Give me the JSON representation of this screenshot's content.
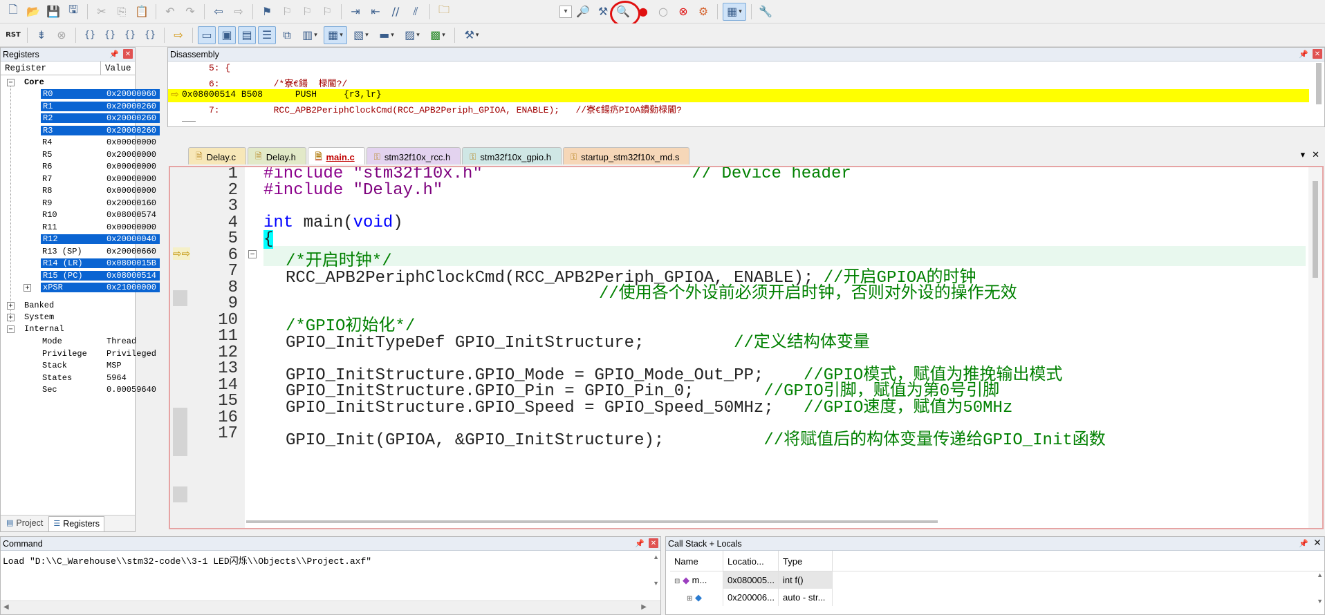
{
  "toolbar1": {
    "icons": [
      "new-file-icon",
      "open-folder-icon",
      "save-icon",
      "save-all-icon",
      "cut-icon",
      "copy-icon",
      "paste-icon",
      "undo-icon",
      "redo-icon",
      "navigate-back-icon",
      "navigate-forward-icon",
      "bookmark-icon",
      "prev-bookmark-icon",
      "next-bookmark-icon",
      "clear-bookmarks-icon",
      "indent-icon",
      "unindent-icon",
      "comment-icon",
      "uncomment-icon",
      "find-in-files-icon",
      "find-dropdown-icon",
      "incremental-find-icon",
      "configure-icon",
      "start-stop-debug-icon",
      "breakpoint-icon",
      "disable-breakpoint-icon",
      "kill-breakpoints-icon",
      "debug-settings-icon",
      "window-layout-icon",
      "configure-tools-icon"
    ]
  },
  "toolbar2": {
    "icons": [
      "reset-icon",
      "run-icon",
      "stop-icon",
      "step-into-icon",
      "step-over-icon",
      "step-out-icon",
      "run-to-cursor-icon",
      "show-next-statement-icon",
      "command-window-icon",
      "disassembly-window-icon",
      "symbols-window-icon",
      "registers-window-icon",
      "call-stack-window-icon",
      "watch-window-icon",
      "memory-window-icon",
      "serial-window-icon",
      "analysis-window-icon",
      "trace-window-icon",
      "system-viewer-icon",
      "toolbox-icon"
    ]
  },
  "registers": {
    "title": "Registers",
    "col_register": "Register",
    "col_value": "Value",
    "core_label": "Core",
    "rows": [
      {
        "name": "R0",
        "value": "0x20000060"
      },
      {
        "name": "R1",
        "value": "0x20000260"
      },
      {
        "name": "R2",
        "value": "0x20000260"
      },
      {
        "name": "R3",
        "value": "0x20000260"
      },
      {
        "name": "R4",
        "value": "0x00000000"
      },
      {
        "name": "R5",
        "value": "0x20000000"
      },
      {
        "name": "R6",
        "value": "0x00000000"
      },
      {
        "name": "R7",
        "value": "0x00000000"
      },
      {
        "name": "R8",
        "value": "0x00000000"
      },
      {
        "name": "R9",
        "value": "0x20000160"
      },
      {
        "name": "R10",
        "value": "0x08000574"
      },
      {
        "name": "R11",
        "value": "0x00000000"
      },
      {
        "name": "R12",
        "value": "0x20000040"
      },
      {
        "name": "R13 (SP)",
        "value": "0x20000660"
      },
      {
        "name": "R14 (LR)",
        "value": "0x0800015B"
      },
      {
        "name": "R15 (PC)",
        "value": "0x08000514"
      },
      {
        "name": "xPSR",
        "value": "0x21000000"
      }
    ],
    "groups": [
      "Banked",
      "System",
      "Internal"
    ],
    "internal": [
      {
        "name": "Mode",
        "value": "Thread"
      },
      {
        "name": "Privilege",
        "value": "Privileged"
      },
      {
        "name": "Stack",
        "value": "MSP"
      },
      {
        "name": "States",
        "value": "5964"
      },
      {
        "name": "Sec",
        "value": "0.00059640"
      }
    ],
    "tabs": [
      "Project",
      "Registers"
    ]
  },
  "disassembly": {
    "title": "Disassembly",
    "lines": [
      "     5: {",
      "     6:          /*寮€鍚  椂閽?/",
      "0x08000514 B508      PUSH     {r3,lr}",
      "     7:          RCC_APB2PeriphClockCmd(RCC_APB2Periph_GPIOA, ENABLE);   //寮€鍚疓PIOA鐨勬椂閽?"
    ]
  },
  "editor": {
    "tabs": [
      "Delay.c",
      "Delay.h",
      "main.c",
      "stm32f10x_rcc.h",
      "stm32f10x_gpio.h",
      "startup_stm32f10x_md.s"
    ],
    "line_numbers": [
      "1",
      "2",
      "3",
      "4",
      "5",
      "6",
      "7",
      "8",
      "9",
      "10",
      "11",
      "12",
      "13",
      "14",
      "15",
      "16",
      "17"
    ],
    "lines": {
      "l1_dir": "#include",
      "l1_str": "\"stm32f10x.h\"",
      "l1_cm": "// Device header",
      "l2_dir": "#include",
      "l2_str": "\"Delay.h\"",
      "l4_kw": "int",
      "l4_mid": " main(",
      "l4_kw2": "void",
      "l4_end": ")",
      "l5": "{",
      "l6_cm": "/*开启时钟*/",
      "l7": "RCC_APB2PeriphClockCmd(RCC_APB2Periph_GPIOA, ENABLE);",
      "l7_cm": "//开启GPIOA的时钟",
      "l8_cm": "//使用各个外设前必须开启时钟，否则对外设的操作无效",
      "l10_cm": "/*GPIO初始化*/",
      "l11": "GPIO_InitTypeDef GPIO_InitStructure;",
      "l11_cm": "//定义结构体变量",
      "l13": "GPIO_InitStructure.GPIO_Mode = GPIO_Mode_Out_PP;",
      "l13_cm": "//GPIO模式，赋值为推挽输出模式",
      "l14": "GPIO_InitStructure.GPIO_Pin = GPIO_Pin_0;",
      "l14_cm": "//GPIO引脚，赋值为第0号引脚",
      "l15": "GPIO_InitStructure.GPIO_Speed = GPIO_Speed_50MHz;",
      "l15_cm": "//GPIO速度，赋值为50MHz",
      "l17": "GPIO_Init(GPIOA, &GPIO_InitStructure);",
      "l17_cm": "//将赋值后的构体变量传递给GPIO_Init函数"
    }
  },
  "command": {
    "title": "Command",
    "text": "Load \"D:\\\\C_Warehouse\\\\stm32-code\\\\3-1 LED闪烁\\\\Objects\\\\Project.axf\""
  },
  "callstack": {
    "title": "Call Stack + Locals",
    "col_name": "Name",
    "col_location": "Locatio...",
    "col_type": "Type",
    "rows": [
      {
        "name": "m...",
        "location": "0x080005...",
        "type": "int f()"
      },
      {
        "name": "",
        "location": "0x200006...",
        "type": "auto - str..."
      }
    ]
  }
}
